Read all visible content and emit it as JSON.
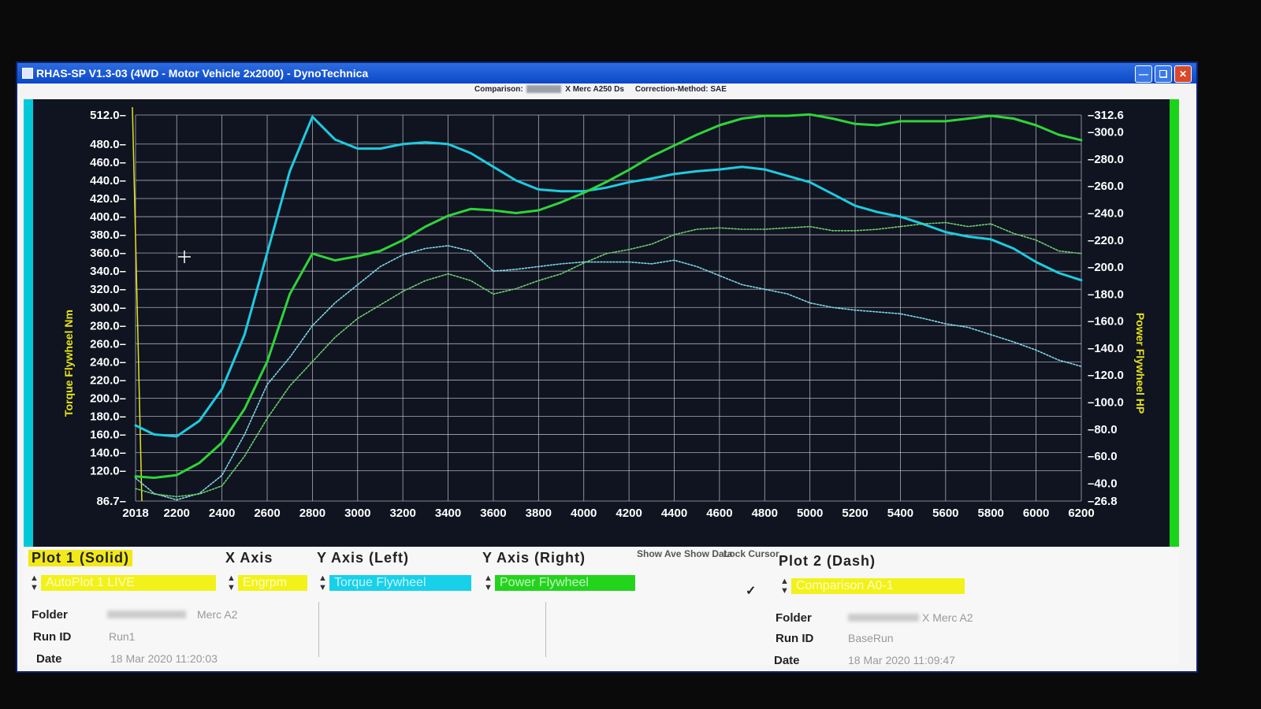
{
  "window": {
    "title": "RHAS-SP V1.3-03  (4WD - Motor Vehicle 2x2000) - DynoTechnica",
    "controls": [
      "minimize-icon",
      "restore-icon",
      "close-icon"
    ]
  },
  "header": {
    "comparison_label": "Comparison:",
    "comparison_value": "X Merc A250 Ds",
    "correction": "Correction-Method: SAE"
  },
  "chart_data": {
    "type": "line",
    "xlabel": "",
    "ylabel_left": "Torque Flywheel Nm",
    "ylabel_right": "Power Flywheel HP",
    "xlim": [
      2018,
      6200
    ],
    "x_ticks": [
      "2018",
      "2200",
      "2400",
      "2600",
      "2800",
      "3000",
      "3200",
      "3400",
      "3600",
      "3800",
      "4000",
      "4200",
      "4400",
      "4600",
      "4800",
      "5000",
      "5200",
      "5400",
      "5600",
      "5800",
      "6000",
      "6200"
    ],
    "ylim_left": [
      86.7,
      512.0
    ],
    "ylim_right": [
      26.8,
      312.6
    ],
    "y_left_ticks": [
      {
        "v": 512.0,
        "t": "512.0"
      },
      {
        "v": 480.0,
        "t": "480.0"
      },
      {
        "v": 460.0,
        "t": "460.0"
      },
      {
        "v": 440.0,
        "t": "440.0"
      },
      {
        "v": 420.0,
        "t": "420.0"
      },
      {
        "v": 400.0,
        "t": "400.0"
      },
      {
        "v": 380.0,
        "t": "380.0"
      },
      {
        "v": 360.0,
        "t": "360.0"
      },
      {
        "v": 340.0,
        "t": "340.0"
      },
      {
        "v": 320.0,
        "t": "320.0"
      },
      {
        "v": 300.0,
        "t": "300.0"
      },
      {
        "v": 280.0,
        "t": "280.0"
      },
      {
        "v": 260.0,
        "t": "260.0"
      },
      {
        "v": 240.0,
        "t": "240.0"
      },
      {
        "v": 220.0,
        "t": "220.0"
      },
      {
        "v": 200.0,
        "t": "200.0"
      },
      {
        "v": 180.0,
        "t": "180.0"
      },
      {
        "v": 160.0,
        "t": "160.0"
      },
      {
        "v": 140.0,
        "t": "140.0"
      },
      {
        "v": 120.0,
        "t": "120.0"
      },
      {
        "v": 86.7,
        "t": "86.7"
      }
    ],
    "y_right_ticks": [
      {
        "v": 312.6,
        "t": "312.6"
      },
      {
        "v": 300.0,
        "t": "300.0"
      },
      {
        "v": 280.0,
        "t": "280.0"
      },
      {
        "v": 260.0,
        "t": "260.0"
      },
      {
        "v": 240.0,
        "t": "240.0"
      },
      {
        "v": 220.0,
        "t": "220.0"
      },
      {
        "v": 200.0,
        "t": "200.0"
      },
      {
        "v": 180.0,
        "t": "180.0"
      },
      {
        "v": 160.0,
        "t": "160.0"
      },
      {
        "v": 140.0,
        "t": "140.0"
      },
      {
        "v": 120.0,
        "t": "120.0"
      },
      {
        "v": 100.0,
        "t": "100.0"
      },
      {
        "v": 80.0,
        "t": "80.0"
      },
      {
        "v": 60.0,
        "t": "60.0"
      },
      {
        "v": 40.0,
        "t": "40.0"
      },
      {
        "v": 26.8,
        "t": "26.8"
      }
    ],
    "grid": true,
    "series": [
      {
        "axis": "left",
        "color": "#1ecbe0",
        "style": "solid",
        "x": [
          2018,
          2100,
          2200,
          2300,
          2400,
          2500,
          2600,
          2700,
          2800,
          2900,
          3000,
          3100,
          3200,
          3300,
          3400,
          3500,
          3600,
          3700,
          3800,
          3900,
          4000,
          4100,
          4200,
          4300,
          4400,
          4500,
          4600,
          4700,
          4800,
          4900,
          5000,
          5100,
          5200,
          5300,
          5400,
          5500,
          5600,
          5700,
          5800,
          5900,
          6000,
          6100,
          6200
        ],
        "y": [
          170,
          160,
          158,
          175,
          210,
          270,
          360,
          450,
          510,
          485,
          475,
          475,
          480,
          482,
          480,
          470,
          455,
          440,
          430,
          428,
          428,
          432,
          438,
          442,
          447,
          450,
          452,
          455,
          452,
          445,
          438,
          425,
          412,
          405,
          400,
          392,
          383,
          378,
          375,
          365,
          350,
          338,
          330
        ]
      },
      {
        "axis": "right",
        "color": "#2fd43a",
        "style": "solid",
        "x": [
          2018,
          2100,
          2200,
          2300,
          2400,
          2500,
          2600,
          2700,
          2800,
          2900,
          3000,
          3100,
          3200,
          3300,
          3400,
          3500,
          3600,
          3700,
          3800,
          3900,
          4000,
          4100,
          4200,
          4300,
          4400,
          4500,
          4600,
          4700,
          4800,
          4900,
          5000,
          5100,
          5200,
          5300,
          5400,
          5500,
          5600,
          5700,
          5800,
          5900,
          6000,
          6100,
          6200
        ],
        "y": [
          45,
          44,
          46,
          55,
          70,
          95,
          130,
          180,
          210,
          205,
          208,
          212,
          220,
          230,
          238,
          243,
          242,
          240,
          242,
          248,
          255,
          263,
          272,
          282,
          290,
          298,
          305,
          310,
          312,
          312,
          313,
          310,
          306,
          305,
          308,
          308,
          308,
          310,
          312,
          310,
          305,
          298,
          294
        ]
      },
      {
        "axis": "left",
        "color": "#7fd8e8",
        "style": "dotted",
        "x": [
          2018,
          2100,
          2200,
          2300,
          2400,
          2500,
          2600,
          2700,
          2800,
          2900,
          3000,
          3100,
          3200,
          3300,
          3400,
          3500,
          3600,
          3700,
          3800,
          3900,
          4000,
          4100,
          4200,
          4300,
          4400,
          4500,
          4600,
          4700,
          4800,
          4900,
          5000,
          5100,
          5200,
          5300,
          5400,
          5500,
          5600,
          5700,
          5800,
          5900,
          6000,
          6100,
          6200
        ],
        "y": [
          112,
          95,
          88,
          95,
          115,
          160,
          215,
          245,
          280,
          305,
          325,
          345,
          358,
          365,
          368,
          362,
          340,
          342,
          345,
          348,
          350,
          350,
          350,
          348,
          352,
          345,
          335,
          325,
          320,
          315,
          305,
          300,
          297,
          295,
          293,
          288,
          282,
          278,
          270,
          262,
          253,
          242,
          235
        ]
      },
      {
        "axis": "right",
        "color": "#6fd070",
        "style": "dotted",
        "x": [
          2018,
          2100,
          2200,
          2300,
          2400,
          2500,
          2600,
          2700,
          2800,
          2900,
          3000,
          3100,
          3200,
          3300,
          3400,
          3500,
          3600,
          3700,
          3800,
          3900,
          4000,
          4100,
          4200,
          4300,
          4400,
          4500,
          4600,
          4700,
          4800,
          4900,
          5000,
          5100,
          5200,
          5300,
          5400,
          5500,
          5600,
          5700,
          5800,
          5900,
          6000,
          6100,
          6200
        ],
        "y": [
          36,
          32,
          30,
          32,
          38,
          60,
          88,
          112,
          130,
          148,
          162,
          172,
          182,
          190,
          195,
          190,
          180,
          184,
          190,
          195,
          203,
          210,
          213,
          217,
          224,
          228,
          229,
          228,
          228,
          229,
          230,
          227,
          227,
          228,
          230,
          232,
          233,
          230,
          232,
          225,
          220,
          212,
          210
        ]
      }
    ]
  },
  "bottom": {
    "plot1_label": "Plot 1 (Solid)",
    "x_axis_label": "X Axis",
    "y_left_label": "Y Axis (Left)",
    "y_right_label": "Y Axis (Right)",
    "show_ave_label": "Show Ave",
    "show_data_label": "Show Data",
    "lock_cursor_label": "Lock Cursor",
    "plot2_label": "Plot 2 (Dash)",
    "plot1_select": "AutoPlot 1 LIVE",
    "x_select": "Engrpm",
    "y_left_select": "Torque Flywheel",
    "y_right_select": "Power Flywheel",
    "plot2_select": "Comparison A0-1",
    "checkmark": "✓",
    "folder_label": "Folder",
    "runid_label": "Run ID",
    "date_label": "Date",
    "p1_folder": "Merc A2",
    "p1_runid": "Run1",
    "p1_date": "18 Mar 2020  11:20:03",
    "p2_folder": "X Merc A2",
    "p2_runid": "BaseRun",
    "p2_date": "18 Mar 2020  11:09:47",
    "colors": {
      "yellow": "#f2f21a",
      "cyan": "#18d0e8",
      "green": "#22d41c"
    }
  }
}
